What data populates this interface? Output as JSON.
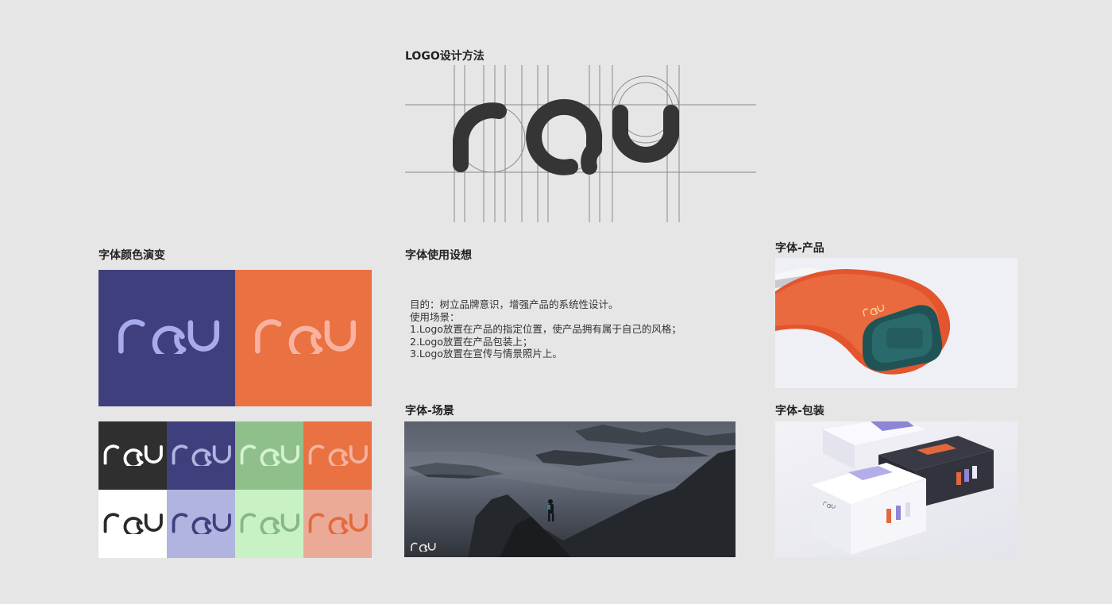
{
  "headings": {
    "logo_method": "LOGO设计方法",
    "color_evolution": "字体颜色演变",
    "usage_idea": "字体使用设想",
    "product": "字体-产品",
    "scene": "字体-场景",
    "packaging": "字体-包装"
  },
  "description": {
    "lines": [
      "目的：树立品牌意识，增强产品的系统性设计。",
      "使用场景：",
      "1.Logo放置在产品的指定位置，使产品拥有属于自己的风格；",
      "2.Logo放置在产品包装上；",
      "3.Logo放置在宣传与情景照片上。"
    ]
  },
  "colors": {
    "background": "#e6e6e6",
    "indigo": "#3f3f7d",
    "orange": "#e97142",
    "dark": "#2f2f2f",
    "green": "#8fc08c",
    "white": "#ffffff",
    "lavender": "#b1b4e0",
    "mint": "#c8f2c4",
    "salmon": "#ebaa97"
  },
  "icons": [
    "ray-logo-icon"
  ]
}
